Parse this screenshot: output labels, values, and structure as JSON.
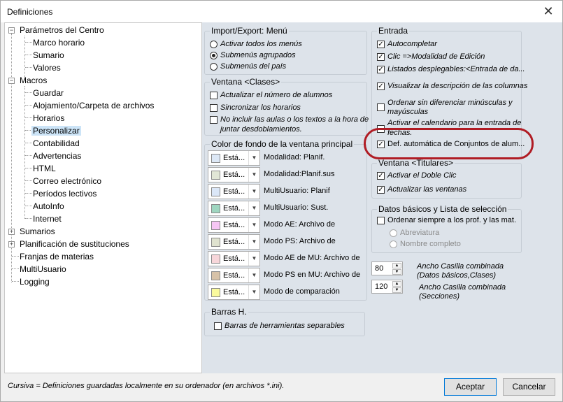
{
  "window": {
    "title": "Definiciones",
    "close_glyph": "✕"
  },
  "tree": {
    "items": [
      {
        "label": "Parámetros del Centro",
        "expander": "−"
      },
      {
        "label": "Marco horario"
      },
      {
        "label": "Sumario"
      },
      {
        "label": "Valores"
      },
      {
        "label": "Macros",
        "expander": "−"
      },
      {
        "label": "Guardar"
      },
      {
        "label": "Alojamiento/Carpeta de archivos"
      },
      {
        "label": "Horarios"
      },
      {
        "label": "Personalizar",
        "selected": true
      },
      {
        "label": "Contabilidad"
      },
      {
        "label": "Advertencias"
      },
      {
        "label": "HTML"
      },
      {
        "label": "Correo electrónico"
      },
      {
        "label": "Períodos lectivos"
      },
      {
        "label": "AutoInfo"
      },
      {
        "label": "Internet"
      },
      {
        "label": "Sumarios",
        "expander": "+"
      },
      {
        "label": "Planificación de sustituciones",
        "expander": "+"
      },
      {
        "label": "Franjas de materias"
      },
      {
        "label": "MultiUsuario"
      },
      {
        "label": "Logging"
      }
    ]
  },
  "import_export": {
    "title": "Import/Export: Menú",
    "options": [
      {
        "label": "Activar todos los menús",
        "selected": false
      },
      {
        "label": "Submenús agrupados",
        "selected": true
      },
      {
        "label": "Submenús del país",
        "selected": false
      }
    ]
  },
  "ventana_clases": {
    "title": "Ventana <Clases>",
    "options": [
      {
        "label": "Actualizar el número de alumnos",
        "checked": false
      },
      {
        "label": "Sincronizar los horarios",
        "checked": false
      },
      {
        "label_line1": "No incluir las aulas o los textos a la hora de",
        "label_line2": "juntar desdoblamientos.",
        "checked": false
      }
    ]
  },
  "color_fondo": {
    "title": "Color de fondo de la ventana principal",
    "rows": [
      {
        "combo": "Está...",
        "swatch": "#dde8f6",
        "label": "Modalidad: Planif."
      },
      {
        "combo": "Está...",
        "swatch": "#e1e6d6",
        "label": "Modalidad:Planif.sus"
      },
      {
        "combo": "Está...",
        "swatch": "#dbe7f8",
        "label": "MultiUsuario: Planif"
      },
      {
        "combo": "Está...",
        "swatch": "#9fd6c0",
        "label": "MultiUsuario: Sust."
      },
      {
        "combo": "Está...",
        "swatch": "#f6c6f4",
        "label": "Modo AE: Archivo de"
      },
      {
        "combo": "Está...",
        "swatch": "#dfe2cf",
        "label": "Modo PS: Archivo de"
      },
      {
        "combo": "Está...",
        "swatch": "#f7d6da",
        "label": "Modo AE de MU: Archivo de"
      },
      {
        "combo": "Está...",
        "swatch": "#d7c2a8",
        "label": "Modo PS en MU: Archivo de"
      },
      {
        "combo": "Está...",
        "swatch": "#fafa9c",
        "label": "Modo de comparación"
      }
    ]
  },
  "barras": {
    "title": "Barras H.",
    "options": [
      {
        "label": "Barras de herramientas separables",
        "checked": false
      }
    ]
  },
  "entrada": {
    "title": "Entrada",
    "options": [
      {
        "label": "Autocompletar",
        "checked": true
      },
      {
        "label": "Clic =>Modalidad de Edición",
        "checked": true
      },
      {
        "label": "Listados desplegables:<Entrada de da...",
        "checked": true
      },
      {
        "label": "Visualizar la descripción de las columnas",
        "checked": true
      },
      {
        "label_line1": "Ordenar sin diferenciar minúsculas y",
        "label_line2": "mayúsculas",
        "checked": false
      },
      {
        "label_line1": "Activar el calendario para la entrada de",
        "label_line2": "fechas.",
        "checked": false
      },
      {
        "label": "Def. automática de Conjuntos de alum...",
        "checked": true
      }
    ]
  },
  "ventana_titulares": {
    "title": "Ventana <Titulares>",
    "options": [
      {
        "label": "Activar el Doble Clic",
        "checked": true
      },
      {
        "label": "Actualizar las ventanas",
        "checked": true
      }
    ]
  },
  "datos_basicos": {
    "title": "Datos básicos y Lista de selección",
    "checkbox": {
      "label": "Ordenar siempre a los prof. y las mat.",
      "checked": false
    },
    "radios": [
      {
        "label": "Abreviatura",
        "selected": false
      },
      {
        "label": "Nombre completo",
        "selected": false
      }
    ]
  },
  "spinners": [
    {
      "value": "80",
      "label_line1": "Ancho Casilla combinada",
      "label_line2": "(Datos básicos,Clases)"
    },
    {
      "value": "120",
      "label_line1": "Ancho Casilla combinada",
      "label_line2": "(Secciones)"
    }
  ],
  "footer": {
    "note": "Cursiva = Definiciones guardadas localmente en su ordenador (en archivos *.ini).",
    "accept": "Aceptar",
    "cancel": "Cancelar"
  },
  "glyphs": {
    "check": "✓",
    "arrow_down": "▼",
    "arrow_up": "▲",
    "spin_down": "▼"
  },
  "colors": {
    "highlight": "#b01c24",
    "panel": "#dde3ea",
    "selection": "#cce4f7"
  }
}
